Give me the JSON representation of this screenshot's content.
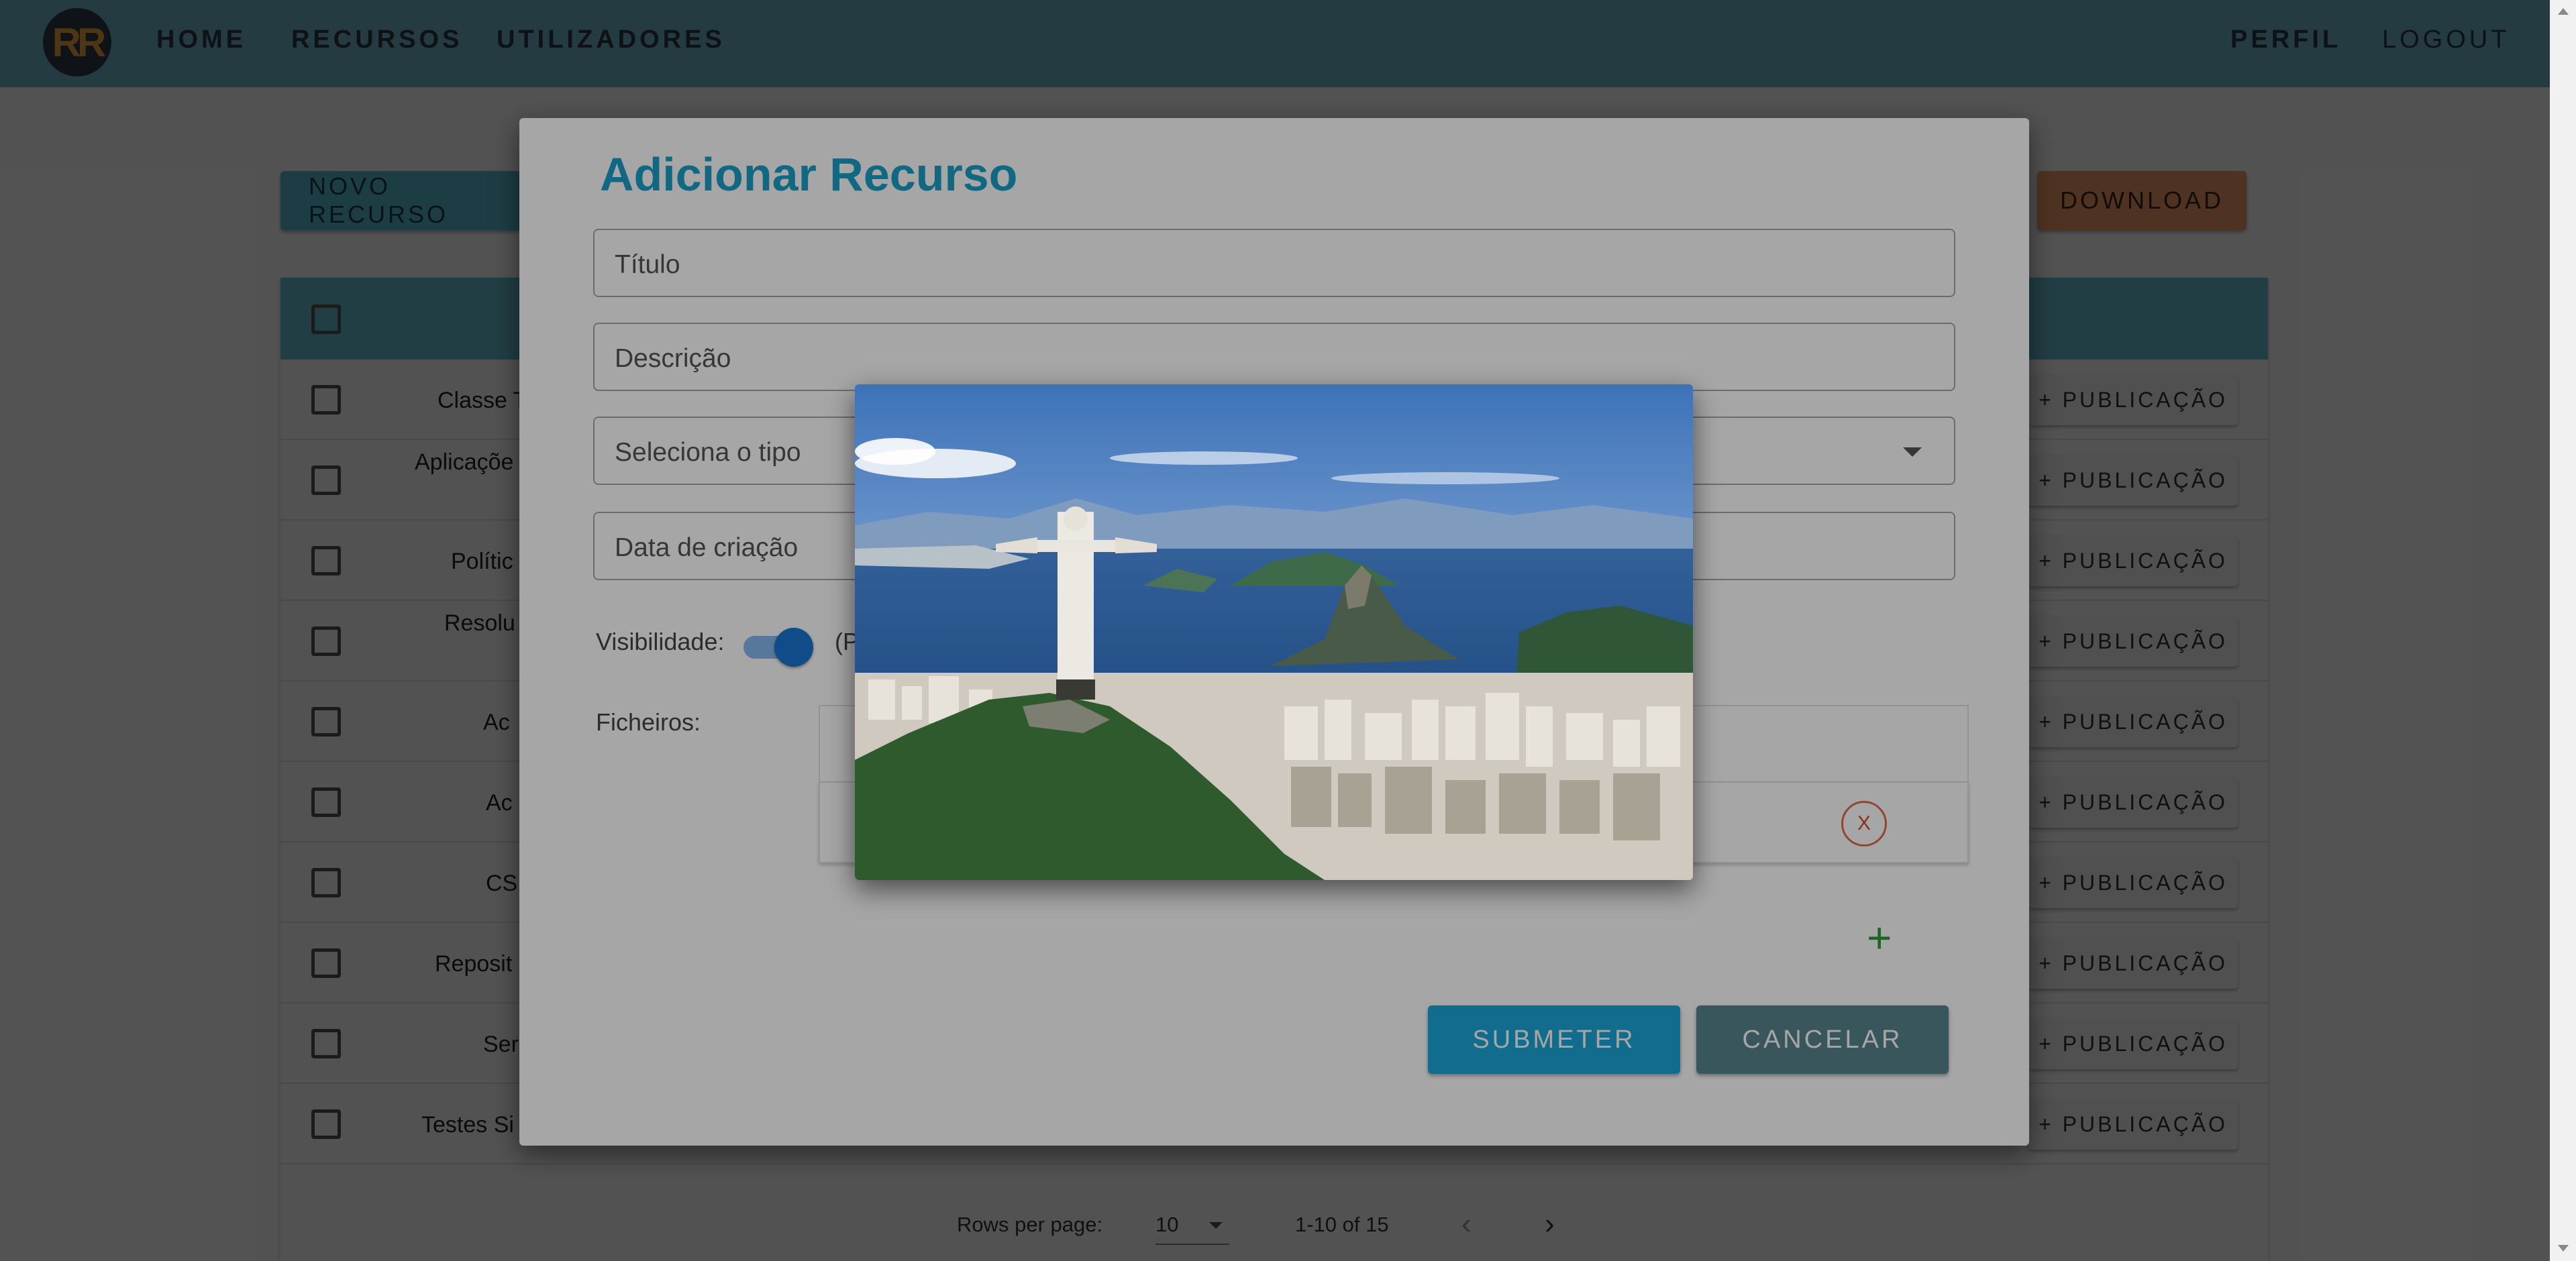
{
  "navbar": {
    "logo_text": "RR",
    "home": "HOME",
    "resources": "RECURSOS",
    "users": "UTILIZADORES",
    "profile": "PERFIL",
    "logout": "LOGOUT"
  },
  "toolbar": {
    "new_resource": "NOVO RECURSO",
    "download": "DOWNLOAD"
  },
  "table": {
    "rows": [
      {
        "title": "Classe T",
        "action": "+ PUBLICAÇÃO"
      },
      {
        "title": "Aplicaçõe",
        "action": "+ PUBLICAÇÃO"
      },
      {
        "title": "Polític",
        "action": "+ PUBLICAÇÃO"
      },
      {
        "title": "Resolu",
        "action": "+ PUBLICAÇÃO"
      },
      {
        "title": "Ac",
        "action": "+ PUBLICAÇÃO"
      },
      {
        "title": "Ac",
        "action": "+ PUBLICAÇÃO"
      },
      {
        "title": "CS",
        "action": "+ PUBLICAÇÃO"
      },
      {
        "title": "Reposit",
        "action": "+ PUBLICAÇÃO"
      },
      {
        "title": "Ser",
        "action": "+ PUBLICAÇÃO"
      },
      {
        "title": "Testes Si",
        "action": "+ PUBLICAÇÃO"
      }
    ],
    "pagination": {
      "rows_per_page_label": "Rows per page:",
      "rows_per_page_value": "10",
      "range": "1-10 of 15"
    }
  },
  "dialog": {
    "title": "Adicionar Recurso",
    "title_placeholder": "Título",
    "description_placeholder": "Descrição",
    "type_placeholder": "Seleciona o tipo",
    "date_placeholder": "Data de criação",
    "visibility_label": "Visibilidade:",
    "visibility_tail": "(P",
    "files_label": "Ficheiros:",
    "remove_label": "X",
    "add_label": "+",
    "submit": "SUBMETER",
    "cancel": "CANCELAR"
  },
  "colors": {
    "navbar": "#6fb6c9",
    "accent": "#1ba0c8",
    "submit": "#1ba7d9",
    "cancel": "#5a8590",
    "download": "#f59f6a",
    "toggle": "#1976d2"
  },
  "icons": {
    "select_caret": "chevron-down-icon",
    "pagination_prev": "chevron-left-icon",
    "pagination_next": "chevron-right-icon",
    "add_file": "plus-icon",
    "remove_file": "close-icon"
  }
}
